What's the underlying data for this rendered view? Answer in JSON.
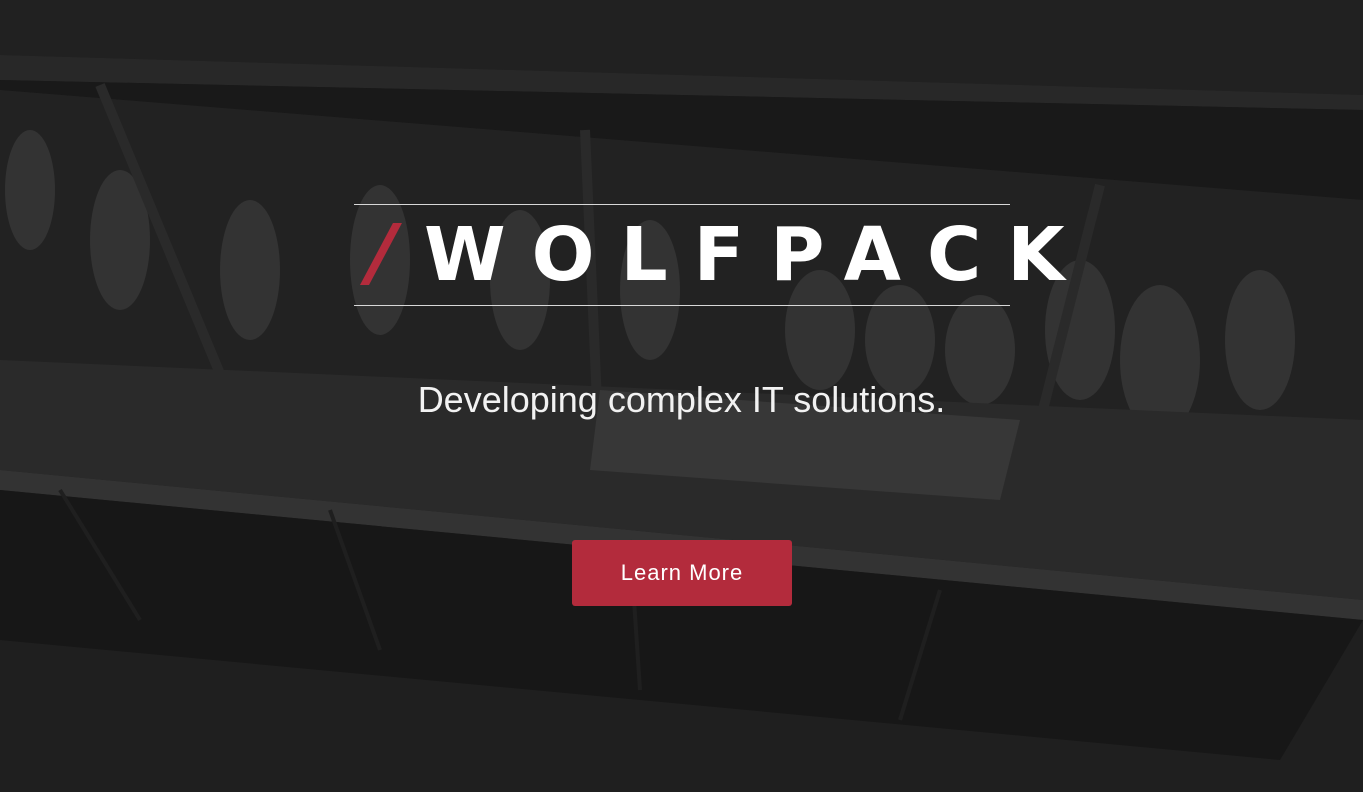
{
  "hero": {
    "logo_text": "WOLFPACK",
    "tagline": "Developing complex IT solutions.",
    "cta_label": "Learn More"
  },
  "colors": {
    "accent": "#b32b3c",
    "text": "#ffffff"
  },
  "icons": {
    "logo_mark": "slash-icon"
  }
}
